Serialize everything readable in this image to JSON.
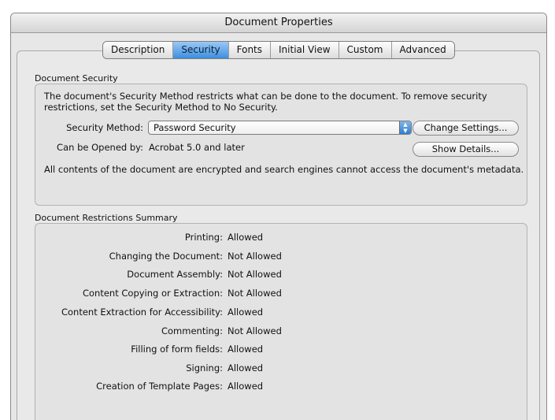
{
  "window": {
    "title": "Document Properties"
  },
  "tabs": [
    {
      "label": "Description",
      "active": false
    },
    {
      "label": "Security",
      "active": true
    },
    {
      "label": "Fonts",
      "active": false
    },
    {
      "label": "Initial View",
      "active": false
    },
    {
      "label": "Custom",
      "active": false
    },
    {
      "label": "Advanced",
      "active": false
    }
  ],
  "security": {
    "section_title": "Document Security",
    "intro": "The document's Security Method restricts what can be done to the document. To remove security restrictions, set the Security Method to No Security.",
    "method_label": "Security Method:",
    "method_value": "Password Security",
    "change_settings_button": "Change Settings...",
    "opened_by_label": "Can be Opened by:",
    "opened_by_value": "Acrobat 5.0 and later",
    "show_details_button": "Show Details...",
    "encryption_note": "All contents of the document are encrypted and search engines cannot access the document's metadata."
  },
  "restrictions": {
    "section_title": "Document Restrictions Summary",
    "items": [
      {
        "label": "Printing:",
        "value": "Allowed"
      },
      {
        "label": "Changing the Document:",
        "value": "Not Allowed"
      },
      {
        "label": "Document Assembly:",
        "value": "Not Allowed"
      },
      {
        "label": "Content Copying or Extraction:",
        "value": "Not Allowed"
      },
      {
        "label": "Content Extraction for Accessibility:",
        "value": "Allowed"
      },
      {
        "label": "Commenting:",
        "value": "Not Allowed"
      },
      {
        "label": "Filling of form fields:",
        "value": "Allowed"
      },
      {
        "label": "Signing:",
        "value": "Allowed"
      },
      {
        "label": "Creation of Template Pages:",
        "value": "Allowed"
      }
    ]
  }
}
